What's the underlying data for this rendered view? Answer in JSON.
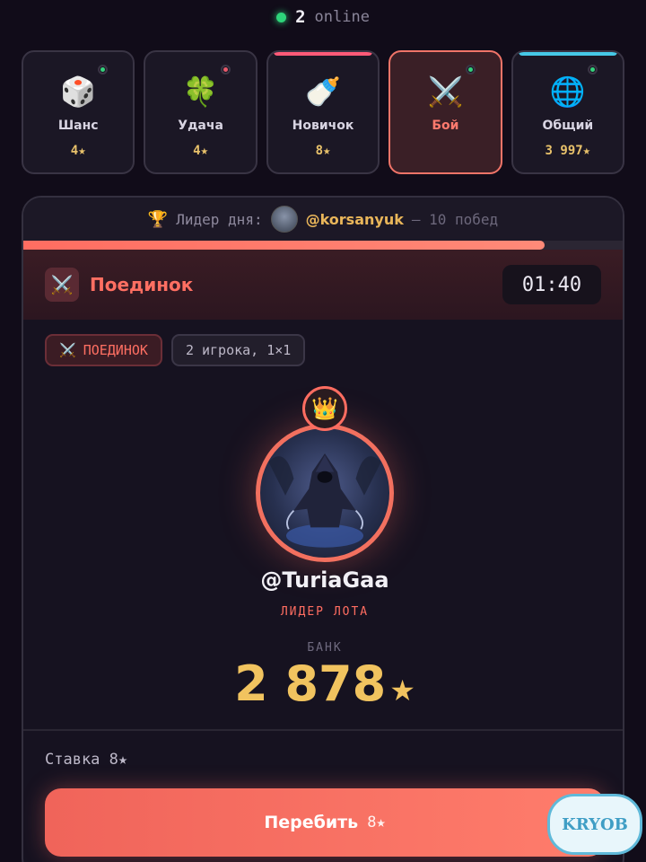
{
  "online": {
    "count": "2",
    "label": "online"
  },
  "modes": [
    {
      "name": "Шанс",
      "value": "4★",
      "icon": "🎲",
      "icon_name": "dice-icon",
      "indicator": "green",
      "bar_color": null
    },
    {
      "name": "Удача",
      "value": "4★",
      "icon": "🍀",
      "icon_name": "clover-icon",
      "indicator": "red",
      "bar_color": null
    },
    {
      "name": "Новичок",
      "value": "8★",
      "icon": "🍼",
      "icon_name": "baby-bottle-icon",
      "indicator": null,
      "bar_color": "#ff5a78"
    },
    {
      "name": "Бой",
      "value": "",
      "icon": "⚔️",
      "icon_name": "crossed-swords-icon",
      "indicator": "green",
      "bar_color": null,
      "active": true
    },
    {
      "name": "Общий",
      "value": "3 997★",
      "icon": "🌐",
      "icon_name": "globe-icon",
      "indicator": "green",
      "bar_color": "#46c8e6"
    }
  ],
  "leader": {
    "trophy": "🏆",
    "label": "Лидер дня:",
    "username": "@korsanyuk",
    "wins": "— 10 побед"
  },
  "round_progress": 0.87,
  "duel": {
    "icon": "⚔️",
    "title": "Поединок",
    "timer": "01:40"
  },
  "tags": {
    "mode_icon": "⚔️",
    "mode": "ПОЕДИНОК",
    "players": "2 игрока, 1×1"
  },
  "hero": {
    "crown": "👑",
    "username": "@TuriaGaa",
    "role": "ЛИДЕР ЛОТА"
  },
  "bank": {
    "label": "БАНК",
    "value": "2 878",
    "star": "★"
  },
  "bet": {
    "label": "Ставка 8★"
  },
  "action": {
    "label": "Перебить",
    "amount": "8★"
  },
  "watermark": "KRYOB",
  "colors": {
    "accent": "#ff6d61",
    "gold": "#f1c35f",
    "online": "#2ed47a",
    "background": "#110c19"
  }
}
